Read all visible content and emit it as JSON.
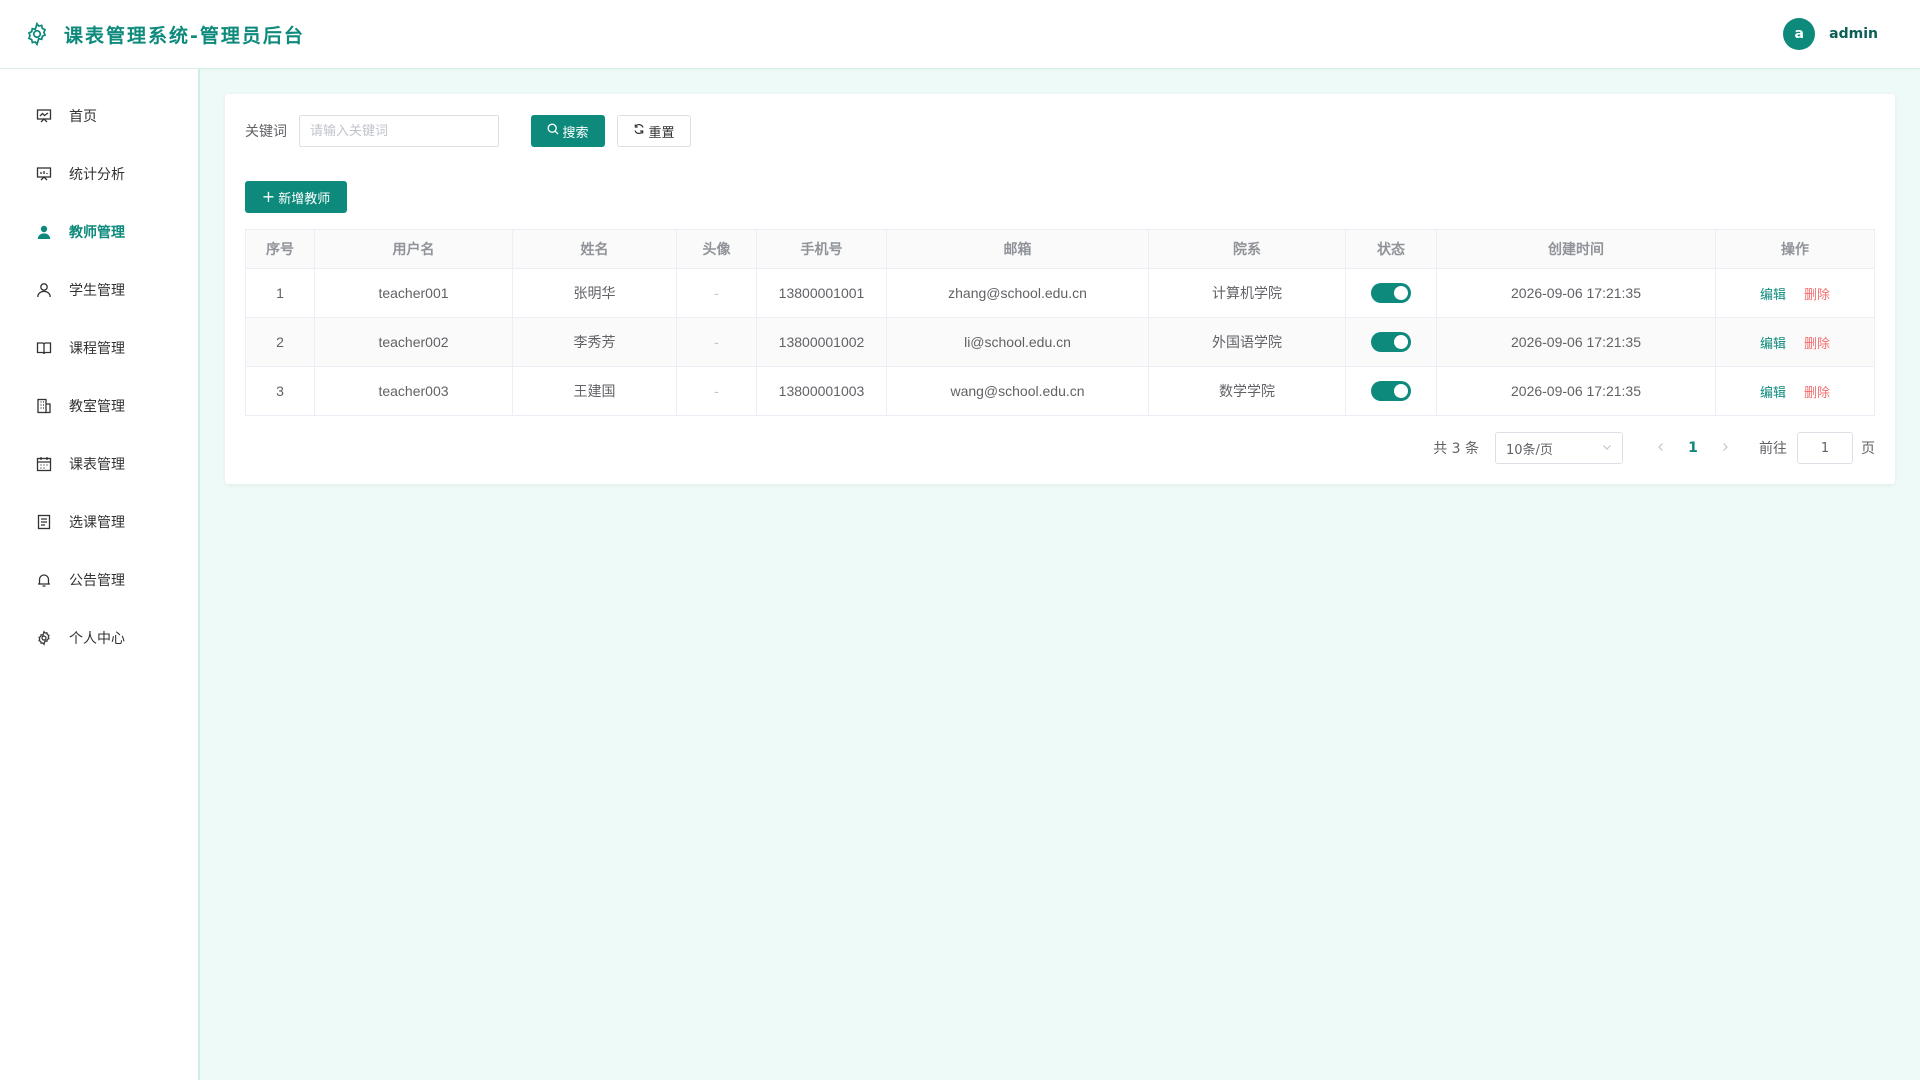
{
  "app": {
    "title": "课表管理系统-管理员后台",
    "logo_icon": "gear-icon",
    "accent_color": "#0d8a7c",
    "danger_color": "#f56c6c"
  },
  "user": {
    "avatar_letter": "a",
    "name": "admin"
  },
  "sidebar": {
    "items": [
      {
        "label": "首页",
        "icon": "presentation-icon",
        "active": false
      },
      {
        "label": "统计分析",
        "icon": "chart-board-icon",
        "active": false
      },
      {
        "label": "教师管理",
        "icon": "user-filled-icon",
        "active": true
      },
      {
        "label": "学生管理",
        "icon": "user-icon",
        "active": false
      },
      {
        "label": "课程管理",
        "icon": "book-icon",
        "active": false
      },
      {
        "label": "教室管理",
        "icon": "building-icon",
        "active": false
      },
      {
        "label": "课表管理",
        "icon": "calendar-icon",
        "active": false
      },
      {
        "label": "选课管理",
        "icon": "document-icon",
        "active": false
      },
      {
        "label": "公告管理",
        "icon": "bell-icon",
        "active": false
      },
      {
        "label": "个人中心",
        "icon": "settings-icon",
        "active": false
      }
    ]
  },
  "search": {
    "label": "关键词",
    "placeholder": "请输入关键词",
    "value": "",
    "search_button": "搜索",
    "reset_button": "重置"
  },
  "toolbar": {
    "add_button": "新增教师"
  },
  "table": {
    "columns": [
      "序号",
      "用户名",
      "姓名",
      "头像",
      "手机号",
      "邮箱",
      "院系",
      "状态",
      "创建时间",
      "操作"
    ],
    "rows": [
      {
        "index": "1",
        "username": "teacher001",
        "name": "张明华",
        "avatar": "-",
        "phone": "13800001001",
        "email": "zhang@school.edu.cn",
        "department": "计算机学院",
        "status": true,
        "created": "2026-09-06 17:21:35",
        "edit": "编辑",
        "delete": "删除"
      },
      {
        "index": "2",
        "username": "teacher002",
        "name": "李秀芳",
        "avatar": "-",
        "phone": "13800001002",
        "email": "li@school.edu.cn",
        "department": "外国语学院",
        "status": true,
        "created": "2026-09-06 17:21:35",
        "edit": "编辑",
        "delete": "删除"
      },
      {
        "index": "3",
        "username": "teacher003",
        "name": "王建国",
        "avatar": "-",
        "phone": "13800001003",
        "email": "wang@school.edu.cn",
        "department": "数学学院",
        "status": true,
        "created": "2026-09-06 17:21:35",
        "edit": "编辑",
        "delete": "删除"
      }
    ]
  },
  "pagination": {
    "total_text": "共 3 条",
    "page_size": "10条/页",
    "current_page": "1",
    "goto_label": "前往",
    "goto_value": "1",
    "page_unit": "页"
  }
}
